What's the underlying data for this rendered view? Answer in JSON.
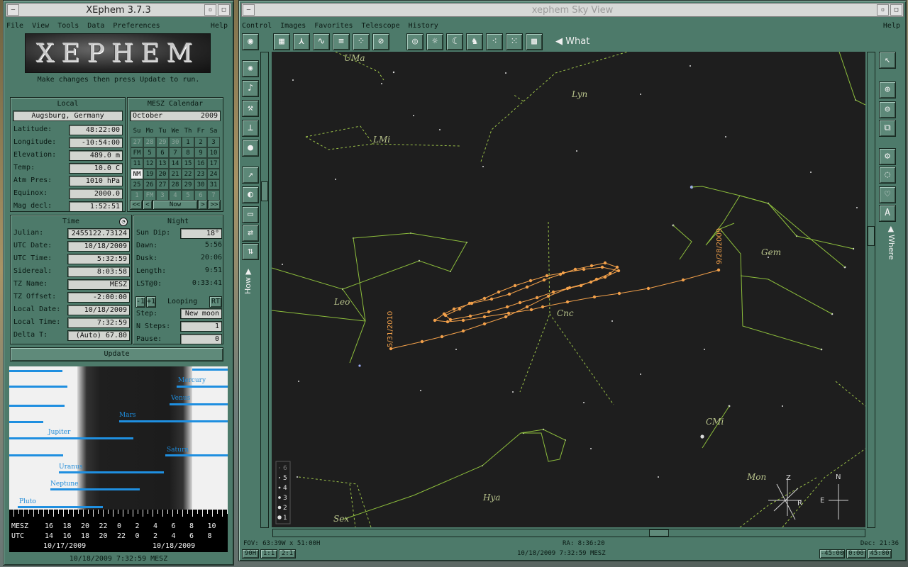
{
  "main": {
    "title": "XEphem 3.7.3",
    "menu": [
      "File",
      "View",
      "Tools",
      "Data",
      "Preferences"
    ],
    "help": "Help",
    "logo": "XEPHEM",
    "hint": "Make changes then press Update to run.",
    "local": {
      "title": "Local",
      "site": "Augsburg, Germany",
      "rows": [
        {
          "label": "Latitude:",
          "value": "48:22:00"
        },
        {
          "label": "Longitude:",
          "value": "-10:54:00"
        },
        {
          "label": "Elevation:",
          "value": "489.0 m"
        },
        {
          "label": "Temp:",
          "value": "10.0 C"
        },
        {
          "label": "Atm Pres:",
          "value": "1010 hPa"
        },
        {
          "label": "Equinox:",
          "value": "2000.0"
        },
        {
          "label": "Mag decl:",
          "value": "1:52:51"
        }
      ]
    },
    "calendar": {
      "title": "MESZ Calendar",
      "month": "October",
      "year": "2009",
      "weekdays": [
        "Su",
        "Mo",
        "Tu",
        "We",
        "Th",
        "Fr",
        "Sa"
      ],
      "rows": [
        [
          "27",
          "28",
          "29",
          "30",
          "1",
          "2",
          "3"
        ],
        [
          "FM",
          "5",
          "6",
          "7",
          "8",
          "9",
          "10"
        ],
        [
          "11",
          "12",
          "13",
          "14",
          "15",
          "16",
          "17"
        ],
        [
          "NM",
          "19",
          "20",
          "21",
          "22",
          "23",
          "24"
        ],
        [
          "25",
          "26",
          "27",
          "28",
          "29",
          "30",
          "31"
        ],
        [
          "1",
          "FM",
          "3",
          "4",
          "5",
          "6",
          "7"
        ]
      ],
      "nav": [
        "<<",
        "<",
        "Now",
        ">",
        ">>"
      ]
    },
    "time": {
      "title": "Time",
      "rows": [
        {
          "label": "Julian:",
          "value": "2455122.73124"
        },
        {
          "label": "UTC Date:",
          "value": "10/18/2009"
        },
        {
          "label": "UTC Time:",
          "value": "5:32:59"
        },
        {
          "label": "Sidereal:",
          "value": "8:03:58"
        },
        {
          "label": "TZ Name:",
          "value": "MESZ"
        },
        {
          "label": "TZ Offset:",
          "value": "-2:00:00"
        },
        {
          "label": "Local Date:",
          "value": "10/18/2009"
        },
        {
          "label": "Local Time:",
          "value": "7:32:59"
        },
        {
          "label": "Delta T:",
          "value": "(Auto)  67.80"
        }
      ]
    },
    "night": {
      "title": "Night",
      "rows": [
        {
          "label": "Sun Dip:",
          "value": "18°"
        },
        {
          "label": "Dawn:",
          "value": "5:56"
        },
        {
          "label": "Dusk:",
          "value": "20:06"
        },
        {
          "label": "Length:",
          "value": "9:51"
        },
        {
          "label": "LST@0:",
          "value": "0:33:41"
        }
      ],
      "looping": "Looping",
      "rt": "RT",
      "minus1": "-1",
      "plus1": "+1",
      "step_label": "Step:",
      "step_value": "New moon",
      "nsteps_label": "N Steps:",
      "nsteps_value": "1",
      "pause_label": "Pause:",
      "pause_value": "0"
    },
    "update": "Update",
    "planets": [
      "Mercury",
      "Venus",
      "Mars",
      "Jupiter",
      "Saturn",
      "Uranus",
      "Neptune",
      "Pluto"
    ],
    "axis": {
      "mesz_label": "MESZ",
      "mesz": [
        "16",
        "18",
        "20",
        "22",
        "0",
        "2",
        "4",
        "6",
        "8",
        "10"
      ],
      "utc_label": "UTC",
      "utc": [
        "14",
        "16",
        "18",
        "20",
        "22",
        "0",
        "2",
        "4",
        "6",
        "8"
      ],
      "date1": "10/17/2009",
      "date2": "10/18/2009"
    },
    "status": "10/18/2009   7:32:59 MESZ"
  },
  "sky": {
    "title": "xephem Sky View",
    "menu": [
      "Control",
      "Images",
      "Favorites",
      "Telescope",
      "History"
    ],
    "help": "Help",
    "what": "What",
    "how": "How",
    "where": "Where",
    "constellations": [
      "UMa",
      "Lyn",
      "LMi",
      "Gem",
      "Leo",
      "Cnc",
      "CMi",
      "Mon",
      "Hya",
      "Sex"
    ],
    "path_dates": [
      "9/28/2009",
      "5/31/2010"
    ],
    "mag_legend": [
      "6",
      "5",
      "4",
      "3",
      "2",
      "1"
    ],
    "compass": {
      "zenith": "Z",
      "right": "R",
      "north": "N",
      "east": "E"
    },
    "fov": "FOV:   63:39W x  51:00H",
    "ra": "RA:   8:36:20",
    "dec": "Dec:  21:36",
    "date": "10/18/2009   7:32:59 MESZ",
    "buttons": [
      "90H",
      "1:1",
      "2:1"
    ],
    "pan": [
      "-45:00",
      "0:00",
      "45:00"
    ]
  },
  "colors": {
    "window": "#4d7a6a",
    "sky": "#1e1e1e",
    "lines": "#9ac048",
    "path": "#f2a04a",
    "planet_bar": "#1f8fe0"
  }
}
